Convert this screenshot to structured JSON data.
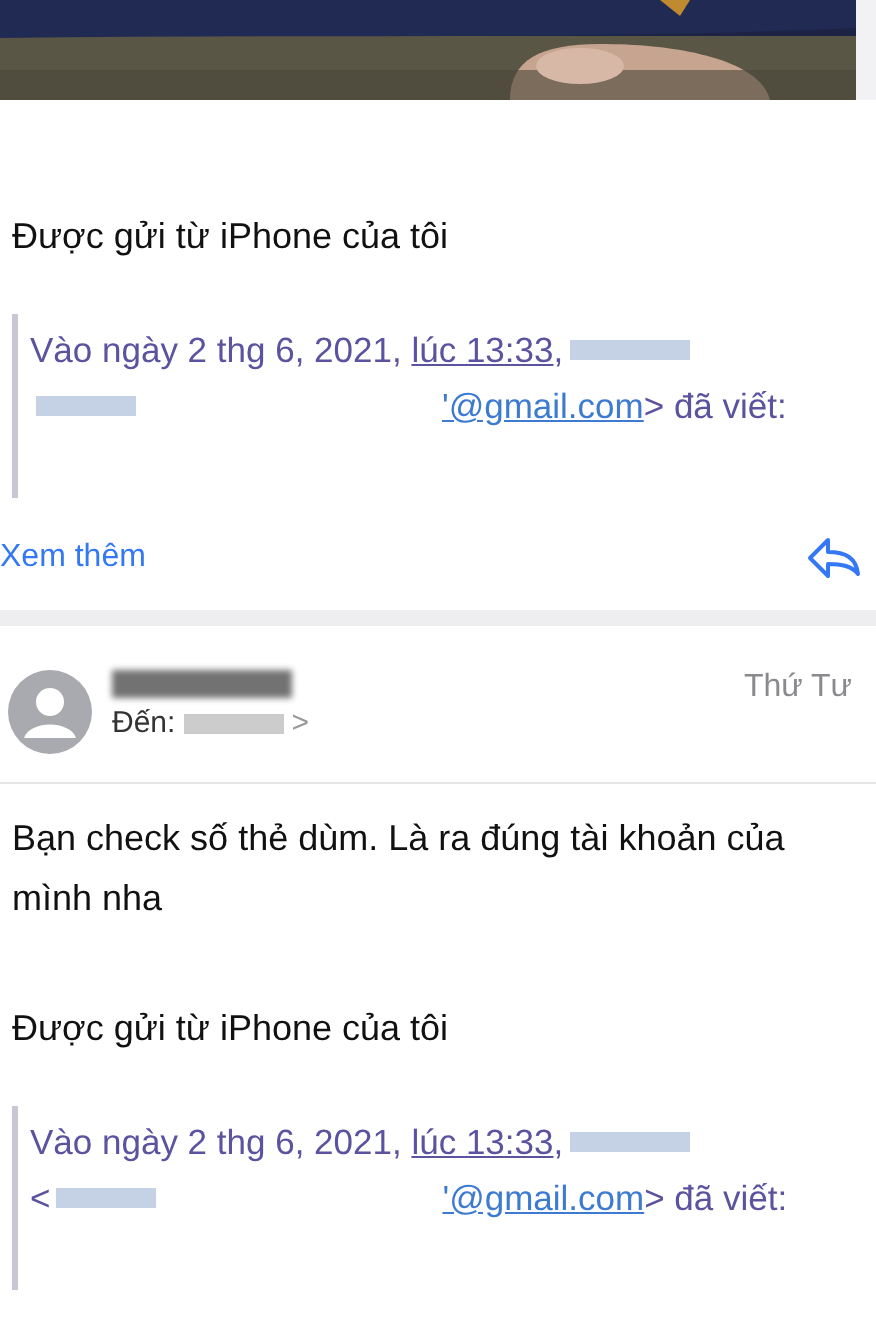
{
  "messages": [
    {
      "kind": "tail",
      "signature": "Được gửi từ iPhone của tôi",
      "quote": {
        "date_text": "Vào ngày 2 thg 6, 2021,",
        "time_link": "lúc 13:33",
        "after_time": ",",
        "email": "'@gmail.com",
        "wrote": "> đã viết:"
      },
      "more": "Xem thêm"
    },
    {
      "kind": "full",
      "date": "Thứ Tư",
      "to_label": "Đến:",
      "chevron": ">",
      "body": "Bạn check số thẻ dùm. Là ra đúng tài khoản của mình nha",
      "signature": "Được gửi từ iPhone của tôi",
      "quote": {
        "date_text": "Vào ngày 2 thg 6, 2021,",
        "time_link": "lúc 13:33",
        "after_time": ",",
        "line2_prefix": "<",
        "email": "'@gmail.com",
        "wrote": "> đã viết:"
      }
    }
  ]
}
